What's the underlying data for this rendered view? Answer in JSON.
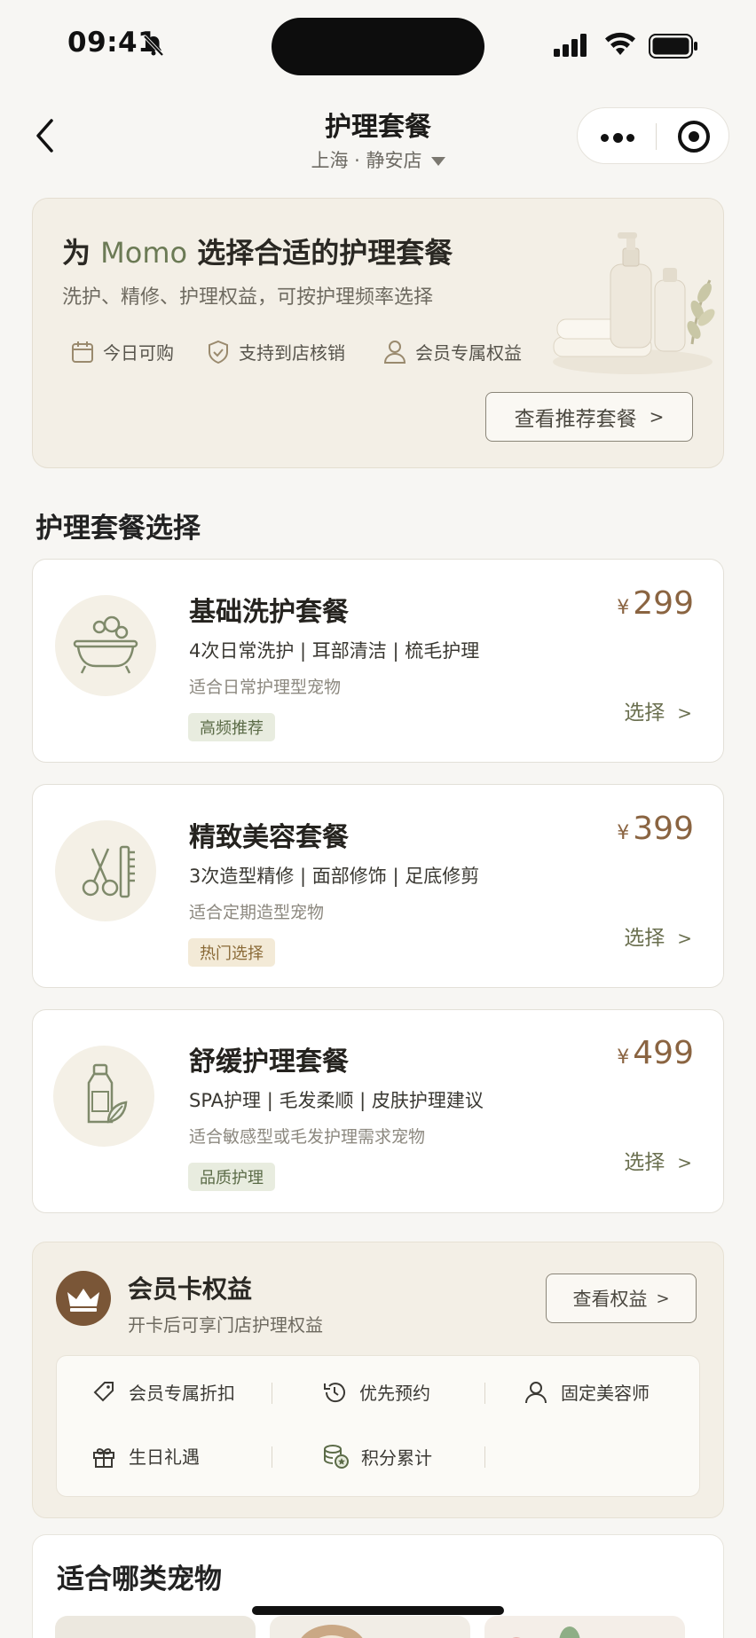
{
  "status": {
    "time": "09:41"
  },
  "nav": {
    "title": "护理套餐",
    "store": "上海 · 静安店"
  },
  "hero": {
    "title_prefix": "为",
    "pet_name": "Momo",
    "title_suffix": "选择合适的护理套餐",
    "desc": "洗护、精修、护理权益，可按护理频率选择",
    "features": [
      "今日可购",
      "支持到店核销",
      "会员专属权益"
    ],
    "button": "查看推荐套餐"
  },
  "section_title": "护理套餐选择",
  "packages": [
    {
      "name": "基础洗护套餐",
      "items": "4次日常洗护 | 耳部清洁 | 梳毛护理",
      "fit": "适合日常护理型宠物",
      "tag": "高频推荐",
      "currency": "¥",
      "price": "299",
      "select": "选择",
      "icon": "bathtub-icon"
    },
    {
      "name": "精致美容套餐",
      "items": "3次造型精修 | 面部修饰 | 足底修剪",
      "fit": "适合定期造型宠物",
      "tag": "热门选择",
      "currency": "¥",
      "price": "399",
      "select": "选择",
      "icon": "scissors-comb-icon"
    },
    {
      "name": "舒缓护理套餐",
      "items": "SPA护理 | 毛发柔顺 | 皮肤护理建议",
      "fit": "适合敏感型或毛发护理需求宠物",
      "tag": "品质护理",
      "currency": "¥",
      "price": "499",
      "select": "选择",
      "icon": "lotion-bottle-icon"
    }
  ],
  "member": {
    "title": "会员卡权益",
    "subtitle": "开卡后可享门店护理权益",
    "button": "查看权益",
    "benefits": [
      "会员专属折扣",
      "优先预约",
      "固定美容师",
      "生日礼遇",
      "积分累计"
    ]
  },
  "pets": {
    "title": "适合哪类宠物"
  },
  "colors": {
    "accent_green": "#6b7a55",
    "price_brown": "#8a6441",
    "crown_bg": "#7a5637"
  }
}
